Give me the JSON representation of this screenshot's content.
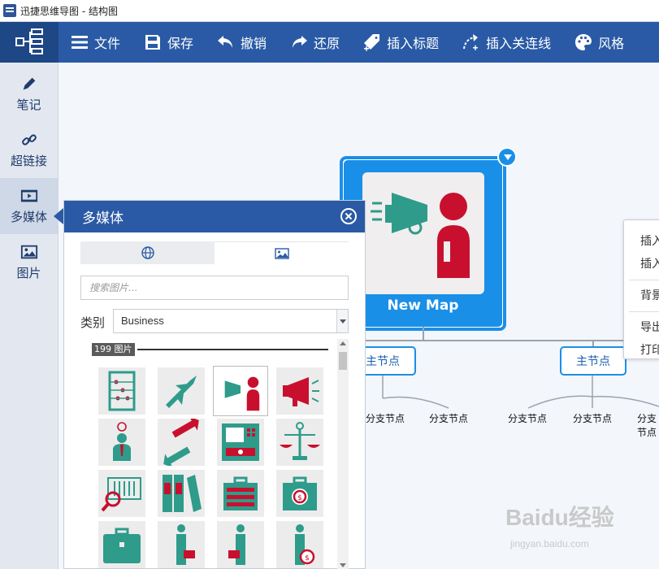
{
  "window": {
    "title": "迅捷思维导图 - 结构图"
  },
  "toolbar": {
    "items": [
      {
        "label": "文件"
      },
      {
        "label": "保存"
      },
      {
        "label": "撤销"
      },
      {
        "label": "还原"
      },
      {
        "label": "插入标题"
      },
      {
        "label": "插入关连线"
      },
      {
        "label": "风格"
      }
    ]
  },
  "sidebar": {
    "items": [
      {
        "label": "笔记"
      },
      {
        "label": "超链接"
      },
      {
        "label": "多媒体"
      },
      {
        "label": "图片"
      }
    ]
  },
  "canvas": {
    "root_label": "New Map",
    "topics": [
      {
        "label": "主节点"
      },
      {
        "label": "主节点"
      }
    ],
    "branches": [
      {
        "label": "分支节点"
      },
      {
        "label": "分支节点"
      },
      {
        "label": "分支节点"
      },
      {
        "label": "分支节点"
      },
      {
        "label": "分支节点"
      }
    ]
  },
  "context_menu": {
    "items": [
      "插入",
      "插入",
      "背景",
      "导出",
      "打印"
    ]
  },
  "panel": {
    "title": "多媒体",
    "search_placeholder": "搜索图片...",
    "category_label": "类别",
    "category_value": "Business",
    "image_count": "199 图片"
  },
  "watermark": {
    "text": "Baidu经验",
    "sub": "jingyan.baidu.com"
  },
  "colors": {
    "primary": "#2a5aa5",
    "accent": "#1a8fe8",
    "teal": "#2f9b8b",
    "red": "#c8102e"
  }
}
